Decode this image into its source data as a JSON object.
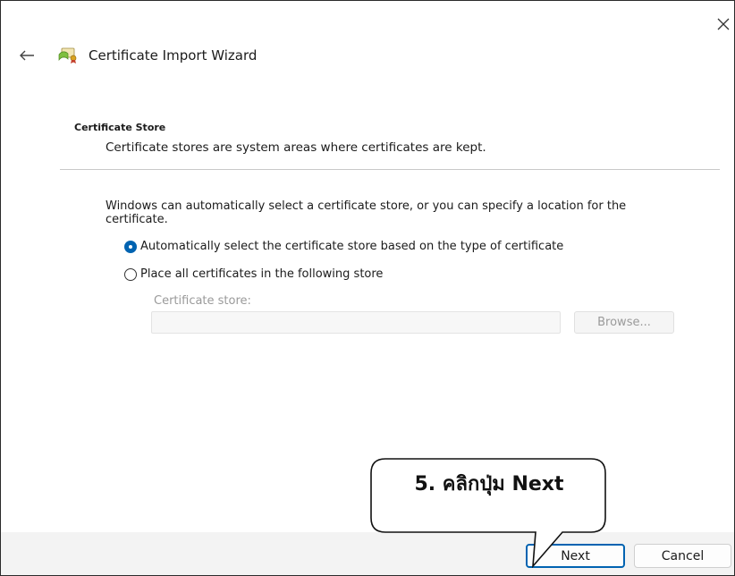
{
  "window": {
    "title": "Certificate Import Wizard",
    "close_icon": "close-icon",
    "back_icon": "back-arrow-icon",
    "app_icon": "certificate-icon"
  },
  "section": {
    "heading": "Certificate Store",
    "subheading": "Certificate stores are system areas where certificates are kept."
  },
  "body": {
    "description": "Windows can automatically select a certificate store, or you can specify a location for the certificate.",
    "options": [
      {
        "label": "Automatically select the certificate store based on the type of certificate",
        "checked": true
      },
      {
        "label": "Place all certificates in the following store",
        "checked": false
      }
    ],
    "store_label": "Certificate store:",
    "store_value": "",
    "browse_label": "Browse..."
  },
  "footer": {
    "next_label": "Next",
    "cancel_label": "Cancel"
  },
  "annotation": {
    "callout_text": "5. คลิกปุ่ม Next"
  },
  "colors": {
    "accent": "#0063b1",
    "footer_bg": "#f3f3f3",
    "disabled_text": "#9a9a9a"
  }
}
